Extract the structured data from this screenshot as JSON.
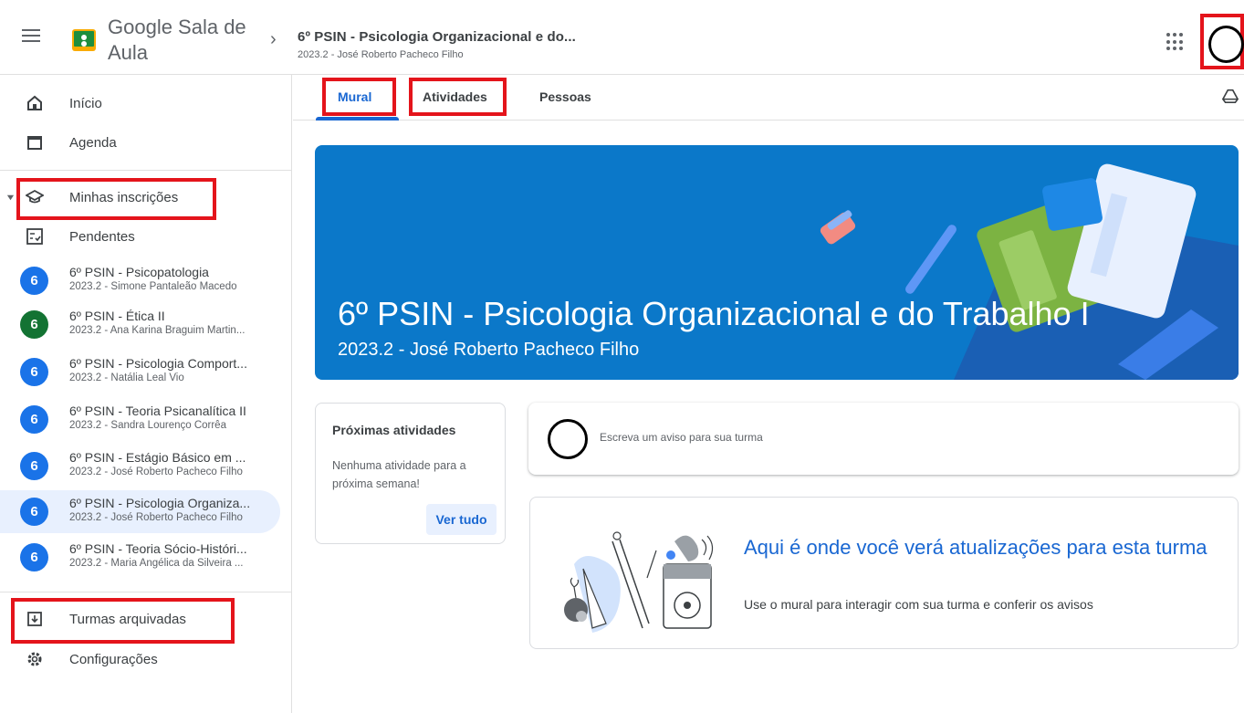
{
  "header": {
    "app_title": "Google Sala de Aula",
    "course_title": "6º PSIN - Psicologia Organizacional e do...",
    "course_subtitle": "2023.2 - José Roberto Pacheco Filho"
  },
  "sidebar": {
    "home": "Início",
    "calendar": "Agenda",
    "enrolled": "Minhas inscrições",
    "todo": "Pendentes",
    "courses": [
      {
        "badge": "6",
        "title": "6º PSIN - Psicopatologia",
        "subtitle": "2023.2 - Simone Pantaleão Macedo",
        "color": "#1a73e8"
      },
      {
        "badge": "6",
        "title": "6º PSIN - Ética II",
        "subtitle": "2023.2 - Ana Karina Braguim Martin...",
        "color": "#137333"
      },
      {
        "badge": "6",
        "title": "6º PSIN - Psicologia Comport...",
        "subtitle": "2023.2 - Natália Leal Vio",
        "color": "#1a73e8"
      },
      {
        "badge": "6",
        "title": "6º PSIN - Teoria Psicanalítica II",
        "subtitle": "2023.2 - Sandra Lourenço Corrêa",
        "color": "#1a73e8"
      },
      {
        "badge": "6",
        "title": "6º PSIN - Estágio Básico em ...",
        "subtitle": "2023.2 - José Roberto Pacheco Filho",
        "color": "#1a73e8"
      },
      {
        "badge": "6",
        "title": "6º PSIN - Psicologia Organiza...",
        "subtitle": "2023.2 - José Roberto Pacheco Filho",
        "color": "#1a73e8"
      },
      {
        "badge": "6",
        "title": "6º PSIN - Teoria Sócio-Históri...",
        "subtitle": "2023.2 - Maria Angélica da Silveira ...",
        "color": "#1a73e8"
      }
    ],
    "archived": "Turmas arquivadas",
    "settings": "Configurações"
  },
  "tabs": [
    "Mural",
    "Atividades",
    "Pessoas"
  ],
  "banner": {
    "title": "6º PSIN - Psicologia Organizacional e do Trabalho I",
    "subtitle": "2023.2 - José Roberto Pacheco Filho"
  },
  "upcoming": {
    "title": "Próximas atividades",
    "text": "Nenhuma atividade para a próxima semana!",
    "see_all": "Ver tudo"
  },
  "announce": {
    "placeholder": "Escreva um aviso para sua turma"
  },
  "empty_state": {
    "title": "Aqui é onde você verá atualizações para esta turma",
    "text": "Use o mural para interagir com sua turma e conferir os avisos"
  },
  "colors": {
    "accent": "#1967d2",
    "banner": "#0b78c9",
    "highlight": "#e4141b"
  }
}
